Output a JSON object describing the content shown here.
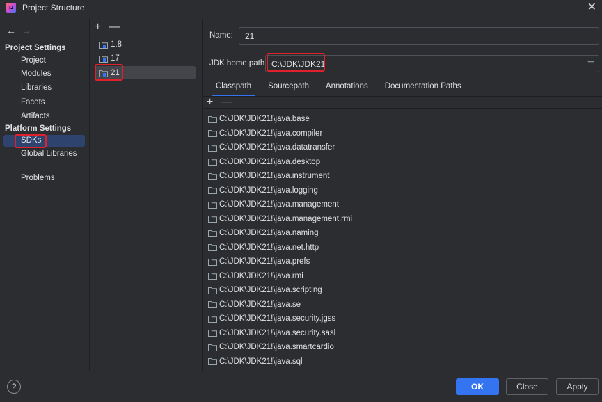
{
  "window": {
    "title": "Project Structure",
    "close_glyph": "✕"
  },
  "nav": {
    "back_glyph": "←",
    "forward_glyph": "→"
  },
  "sidebar": {
    "project_settings_header": "Project Settings",
    "project_items": [
      "Project",
      "Modules",
      "Libraries",
      "Facets",
      "Artifacts"
    ],
    "platform_settings_header": "Platform Settings",
    "platform_items": [
      "SDKs",
      "Global Libraries"
    ],
    "problems": "Problems",
    "selected": "SDKs"
  },
  "sdk_list": {
    "add_glyph": "+",
    "remove_glyph": "—",
    "items": [
      "1.8",
      "17",
      "21"
    ],
    "selected": "21"
  },
  "details": {
    "name_label": "Name:",
    "name_value": "21",
    "jdk_home_label": "JDK home path:",
    "jdk_home_value": "C:\\JDK\\JDK21",
    "tabs": [
      "Classpath",
      "Sourcepath",
      "Annotations",
      "Documentation Paths"
    ],
    "active_tab": "Classpath",
    "list_add_glyph": "+",
    "list_remove_glyph": "—",
    "classpath_entries": [
      "C:\\JDK\\JDK21!\\java.base",
      "C:\\JDK\\JDK21!\\java.compiler",
      "C:\\JDK\\JDK21!\\java.datatransfer",
      "C:\\JDK\\JDK21!\\java.desktop",
      "C:\\JDK\\JDK21!\\java.instrument",
      "C:\\JDK\\JDK21!\\java.logging",
      "C:\\JDK\\JDK21!\\java.management",
      "C:\\JDK\\JDK21!\\java.management.rmi",
      "C:\\JDK\\JDK21!\\java.naming",
      "C:\\JDK\\JDK21!\\java.net.http",
      "C:\\JDK\\JDK21!\\java.prefs",
      "C:\\JDK\\JDK21!\\java.rmi",
      "C:\\JDK\\JDK21!\\java.scripting",
      "C:\\JDK\\JDK21!\\java.se",
      "C:\\JDK\\JDK21!\\java.security.jgss",
      "C:\\JDK\\JDK21!\\java.security.sasl",
      "C:\\JDK\\JDK21!\\java.smartcardio",
      "C:\\JDK\\JDK21!\\java.sql"
    ]
  },
  "footer": {
    "help_glyph": "?",
    "ok_label": "OK",
    "close_label": "Close",
    "apply_label": "Apply"
  },
  "colors": {
    "background": "#2b2d30",
    "selection": "#2e436e",
    "accent": "#3574f0",
    "highlight_box": "#e0202a"
  },
  "icons": {
    "app": "intellij-logo-icon",
    "sdk": "jdk-folder-icon",
    "classpath_entry": "folder-icon",
    "browse": "open-folder-icon"
  }
}
